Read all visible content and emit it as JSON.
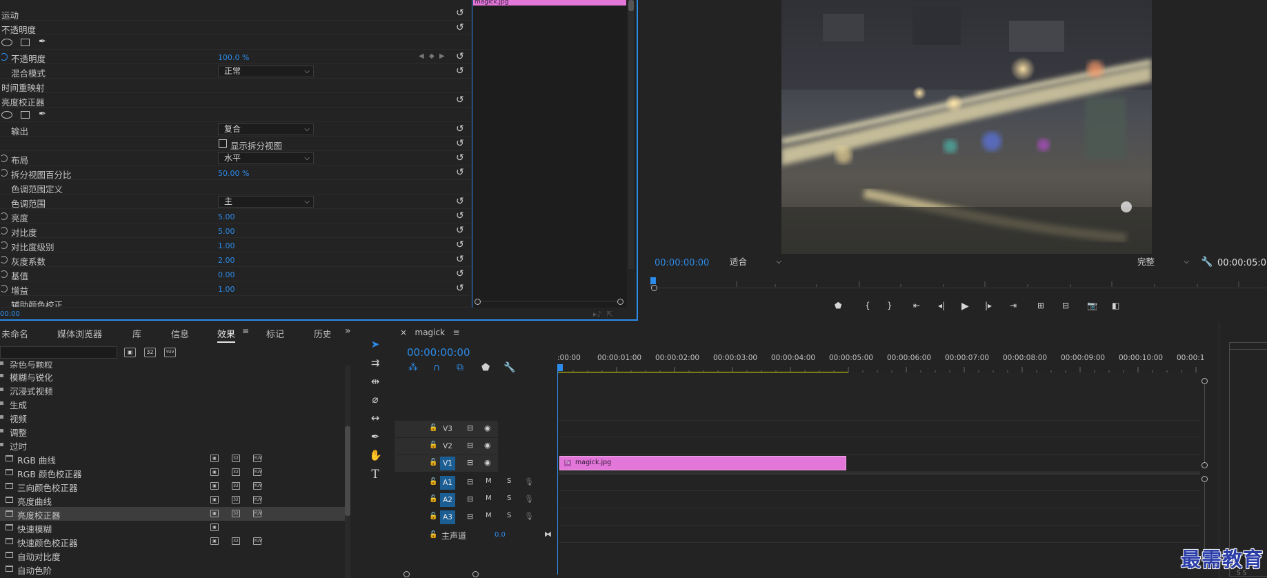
{
  "effect_controls": {
    "clip_label": "magick.jpg",
    "timecode": "00:00",
    "rows": [
      {
        "label": "运动"
      },
      {
        "label": "不透明度"
      },
      {
        "label": "不透明度",
        "value": "100.0 %"
      },
      {
        "label": "混合模式",
        "dropdown": "正常"
      },
      {
        "label": "时间重映射"
      },
      {
        "label": "亮度校正器"
      },
      {
        "label": "输出",
        "dropdown": "复合"
      },
      {
        "checkbox_label": "显示拆分视图"
      },
      {
        "label": "布局",
        "dropdown": "水平"
      },
      {
        "label": "拆分视图百分比",
        "value": "50.00 %"
      },
      {
        "label": "色调范围定义"
      },
      {
        "label": "色调范围",
        "dropdown": "主"
      },
      {
        "label": "亮度",
        "value": "5.00"
      },
      {
        "label": "对比度",
        "value": "5.00"
      },
      {
        "label": "对比度级别",
        "value": "1.00"
      },
      {
        "label": "灰度系数",
        "value": "2.00"
      },
      {
        "label": "基值",
        "value": "0.00"
      },
      {
        "label": "增益",
        "value": "1.00"
      },
      {
        "label": "辅助颜色校正"
      }
    ]
  },
  "program_monitor": {
    "timecode": "00:00:00:00",
    "fit_dropdown": "适合",
    "quality_dropdown": "完整",
    "duration": "00:00:05:0"
  },
  "effects_panel": {
    "tabs": [
      "未命名",
      "媒体浏览器",
      "库",
      "信息",
      "效果",
      "标记",
      "历史"
    ],
    "active_tab": "效果",
    "categories": [
      "模糊与锐化",
      "沉浸式视频",
      "生成",
      "视频",
      "调整",
      "过时"
    ],
    "partial_top": "杂色与颗粒",
    "effects": [
      "RGB 曲线",
      "RGB 颜色校正器",
      "三向颜色校正器",
      "亮度曲线",
      "亮度校正器",
      "快速模糊",
      "快速颜色校正器",
      "自动对比度",
      "自动色阶"
    ],
    "selected_effect": "亮度校正器",
    "badge_labels": [
      "32",
      "YUV"
    ]
  },
  "timeline": {
    "sequence_name": "magick",
    "timecode": "00:00:00:00",
    "ruler_labels": [
      ":00:00",
      "00:00:01:00",
      "00:00:02:00",
      "00:00:03:00",
      "00:00:04:00",
      "00:00:05:00",
      "00:00:06:00",
      "00:00:07:00",
      "00:00:08:00",
      "00:00:09:00",
      "00:00:10:00",
      "00:00:1"
    ],
    "video_tracks": [
      "V3",
      "V2",
      "V1"
    ],
    "audio_tracks": [
      "A1",
      "A2",
      "A3"
    ],
    "mute_label": "M",
    "solo_label": "S",
    "master_label": "主声道",
    "master_value": "0.0",
    "clip_name": "magick.jpg",
    "clip_fx": "fx"
  },
  "mini_panel": {
    "labels": "S    S"
  },
  "watermark": "最需教育",
  "colors": {
    "accent": "#2d8ceb",
    "clip_pink": "#e277d9",
    "work_area": "#e8e800"
  }
}
